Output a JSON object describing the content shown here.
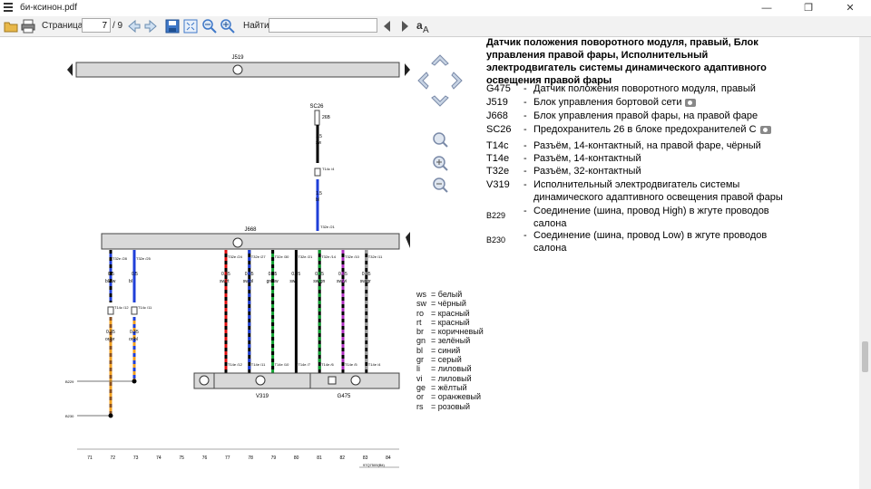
{
  "window": {
    "title": "би-ксинон.pdf",
    "minimize": "—",
    "maximize": "❐",
    "close": "✕"
  },
  "toolbar": {
    "page_label": "Страница:",
    "page_current": "7",
    "page_total": "/ 9",
    "find_label": "Найти:",
    "find_value": "",
    "icons": [
      "open-icon",
      "print-icon",
      "page-back-icon",
      "page-forward-icon",
      "save-icon",
      "fit-page-icon",
      "zoom-out-icon",
      "zoom-in-icon",
      "find-prev-icon",
      "find-next-icon",
      "text-options-icon"
    ]
  },
  "diagram": {
    "top_bar_label": "J519",
    "module_label": "J668",
    "fuse_label": "SC26",
    "fuse_pin": "26B",
    "wire_fuse": {
      "gauge": "1.5",
      "color": "sw"
    },
    "wire_fuse2": {
      "gauge": "1.5",
      "color": "bl"
    },
    "connector_t14c_top": "T14c /4",
    "connector_t32e_top": "T32e /21",
    "left_wires": [
      {
        "conn": "T32e /28",
        "gauge": "0.5",
        "color": "bl/sw",
        "conn2": "T14c /12",
        "gauge2": "0.35",
        "color2": "or/br"
      },
      {
        "conn": "T32e /25",
        "gauge": "0.5",
        "color": "bl",
        "conn2": "T14c /11",
        "gauge2": "0.35",
        "color2": "or/bl"
      }
    ],
    "right_wires": [
      {
        "conn": "T32e /24",
        "gauge": "0.35",
        "color": "sw/rt",
        "conn2": "T14e /12"
      },
      {
        "conn": "T32e /27",
        "gauge": "0.35",
        "color": "sw/bl",
        "conn2": "T14e /11"
      },
      {
        "conn": "T32e /30",
        "gauge": "0.35",
        "color": "gn/sw",
        "conn2": "T14e /10"
      },
      {
        "conn": "T32e /21",
        "gauge": "0.35",
        "color": "sw",
        "conn2": "T14e /7"
      },
      {
        "conn": "T32e /14",
        "gauge": "0.35",
        "color": "sw/gn",
        "conn2": "T14e /6"
      },
      {
        "conn": "T32e /10",
        "gauge": "0.35",
        "color": "sw/vi",
        "conn2": "T14e /5"
      },
      {
        "conn": "T32e /11",
        "gauge": "0.35",
        "color": "sw/gr",
        "conn2": "T14e /4"
      }
    ],
    "bus_labels": [
      "B229",
      "B230"
    ],
    "component_v319": "V319",
    "component_g475": "G475",
    "column_numbers": [
      "71",
      "72",
      "73",
      "74",
      "75",
      "76",
      "77",
      "78",
      "79",
      "80",
      "81",
      "82",
      "83",
      "84"
    ],
    "footer_code": "97Q7509(Bit)"
  },
  "legend": {
    "title": "Датчик положения поворотного модуля, правый, Блок управления правой фары, Исполнительный электродвигатель системы динамического адаптивного освещения правой фары",
    "items": [
      {
        "code": "G475",
        "desc": "Датчик положения поворотного модуля, правый",
        "camera": false
      },
      {
        "code": "J519",
        "desc": "Блок управления бортовой сети",
        "camera": true
      },
      {
        "code": "J668",
        "desc": "Блок управления правой фары, на правой фаре",
        "camera": false
      },
      {
        "code": "SC26",
        "desc": "Предохранитель 26 в блоке предохранителей С",
        "camera": true
      },
      {
        "code": "T14c",
        "desc": "Разъём, 14-контактный, на правой фаре, чёрный",
        "camera": false
      },
      {
        "code": "T14e",
        "desc": "Разъём, 14-контактный",
        "camera": false
      },
      {
        "code": "T32e",
        "desc": "Разъём, 32-контактный",
        "camera": false
      },
      {
        "code": "V319",
        "desc": "Исполнительный электродвигатель системы динамического адаптивного освещения правой фары",
        "camera": false
      },
      {
        "code": "B229",
        "desc": "Соединение (шина, провод High) в жгуте проводов салона",
        "camera": false
      },
      {
        "code": "B230",
        "desc": "Соединение (шина, провод Low) в жгуте проводов салона",
        "camera": false
      }
    ]
  },
  "colors": [
    {
      "code": "ws",
      "name": "белый"
    },
    {
      "code": "sw",
      "name": "чёрный"
    },
    {
      "code": "ro",
      "name": "красный"
    },
    {
      "code": "rt",
      "name": "красный"
    },
    {
      "code": "br",
      "name": "коричневый"
    },
    {
      "code": "gn",
      "name": "зелёный"
    },
    {
      "code": "bl",
      "name": "синий"
    },
    {
      "code": "gr",
      "name": "серый"
    },
    {
      "code": "li",
      "name": "лиловый"
    },
    {
      "code": "vi",
      "name": "лиловый"
    },
    {
      "code": "ge",
      "name": "жёлтый"
    },
    {
      "code": "or",
      "name": "оранжевый"
    },
    {
      "code": "rs",
      "name": "розовый"
    }
  ],
  "wire_colors": {
    "sw": "#000000",
    "bl": "#1f3fd8",
    "rt": "#e01010",
    "gn": "#10a030",
    "vi": "#b030c0",
    "gr": "#999999",
    "or": "#f0a020",
    "br": "#8a5020"
  }
}
